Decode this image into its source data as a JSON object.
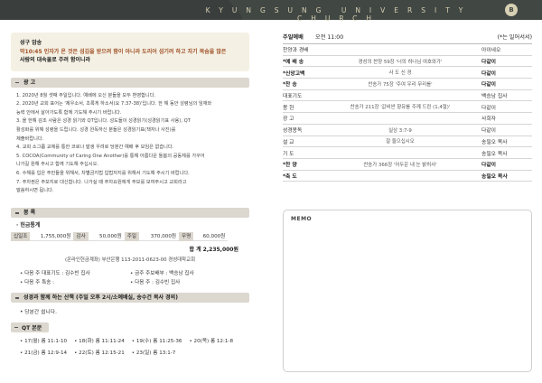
{
  "header": {
    "brand": "KYUNGSUNG UNIVERSITY CHURCH",
    "logo_mark": "B"
  },
  "verse": {
    "title": "성구 암송",
    "ref": "막10:45",
    "line1": "인자가 온 것은 섬김을 받으려 함이 아니라 도리어 섬기려 하고 자기 목숨을 많은",
    "line2": "사람의 대속물로 주려 함이니라"
  },
  "notices": {
    "heading": "광     고",
    "items": [
      "1. 2020년 8월 셋째 주일입니다. 예배에 오신 분들을 모두 환영합니다.",
      "2. 2020년 교회 표어는 '제우소서, 초록게 하소서(요 7:37-38)'입니다. 한 해 동안 성령님의 임재와",
      "    능력 안에서 살아가도록 함께 기도해 주시기 바랍니다.",
      "3. 올 한해 감조 사람은 성경 읽기와 QT입니다. 성도들이 성경읽기(성경읽기표 사용), QT",
      "    활성화를 위해 성령을 드립니다. 성경 완독하신 분들은 성경읽기표(책자나 사진)를",
      "    제출바랍니다.",
      "4. 교회 소그룹 교제를 통한 코로나 발생 우려로 당분간 예배 후 모임은 없습니다.",
      "5. COCOA(Community of Caring One Another)를 통해 아름다운 돌봄의 공동체를 가꾸어",
      "    나가길 원해 주시고 함께 기도해 주십시오.",
      "6. 수해를 입은 주민들을 위해서, 차별금지법 입법저지를 위해서 기도해 주시기 바랍니다.",
      "7. 주차권은 주보지로 대신합니다. 나가실 때 주차요원에게 주보를 보여주시고 교회라고",
      "    말씀하시면 됩니다."
    ]
  },
  "offering": {
    "heading": "봉     록",
    "sub": "· 헌금통계",
    "cells": [
      {
        "label": "십일조",
        "value": "1,755,000원"
      },
      {
        "label": "감사",
        "value": "50,000원"
      },
      {
        "label": "주일",
        "value": "370,000원"
      },
      {
        "label": "무명",
        "value": "60,000원"
      }
    ],
    "total": "합  계  2,235,000원",
    "account": "(온라인헌금계좌) 부산은행 113-2011-0623-00 경성대학교회"
  },
  "duties": [
    "• 다음 주 대표기도 : 김수빈 집사",
    "• 금주 주보배부 : 백승남 집사",
    "• 다음 주 특송 :",
    "• 다음 주 : 김수빈 집사"
  ],
  "walk": {
    "heading": "성경과 함께 하는 산책 (주일 오후 2시/소예배실, 송수건 목사 경의)",
    "note": "• 당분간 쉽니다."
  },
  "qt": {
    "label": "QT 본문",
    "row1": [
      "• 17(월) 롬 11:1-10",
      "• 18(화) 롬 11:11-24",
      "• 19(수) 롬 11:25-36",
      "• 20(목) 롬 12:1-8"
    ],
    "row2": [
      "• 21(금) 롬 12:9-14",
      "• 22(토) 롬 12:15-21",
      "• 23(일) 롬 13:1-7"
    ]
  },
  "worship": {
    "title": "주일예배",
    "time": "오전 11:00",
    "note": "(*는 일어서서)",
    "rows": [
      {
        "role": "찬양과 경배",
        "content": "",
        "leader": "아이네오",
        "bold": false
      },
      {
        "role": "*예 배 송",
        "content": "경성의 찬양 59장 '너의 하나님 여호와가'",
        "leader": "다같이",
        "bold": true
      },
      {
        "role": "*신앙고백",
        "content": "사 도 신 경",
        "leader": "다같이",
        "bold": true
      },
      {
        "role": "*찬    송",
        "content": "찬송가 75장 '주여 우리 무리를'",
        "leader": "다같이",
        "bold": true
      },
      {
        "role": "대표기도",
        "content": "",
        "leader": "백승남 집사",
        "bold": false
      },
      {
        "role": "봉    헌",
        "content": "찬송가 211장 '값비싼 향유를 주께 드린 (1,4절)'",
        "leader": "다같이",
        "bold": false
      },
      {
        "role": "광    고",
        "content": "",
        "leader": "사회자",
        "bold": false
      },
      {
        "role": "성경봉독",
        "content": "실상 3:7-9",
        "leader": "다같이",
        "bold": false
      },
      {
        "role": "설    교",
        "content": "잘 들으십시오",
        "leader": "송필오 목사",
        "bold": false
      },
      {
        "role": "기    도",
        "content": "",
        "leader": "송필오 목사",
        "bold": false
      },
      {
        "role": "*찬    양",
        "content": "찬송가 366장 '어두운 내 눈 밝히사'",
        "leader": "다같이",
        "bold": true
      },
      {
        "role": "*축    도",
        "content": "",
        "leader": "송필오 목사",
        "bold": true
      }
    ]
  },
  "memo": {
    "label": "MEMO"
  }
}
